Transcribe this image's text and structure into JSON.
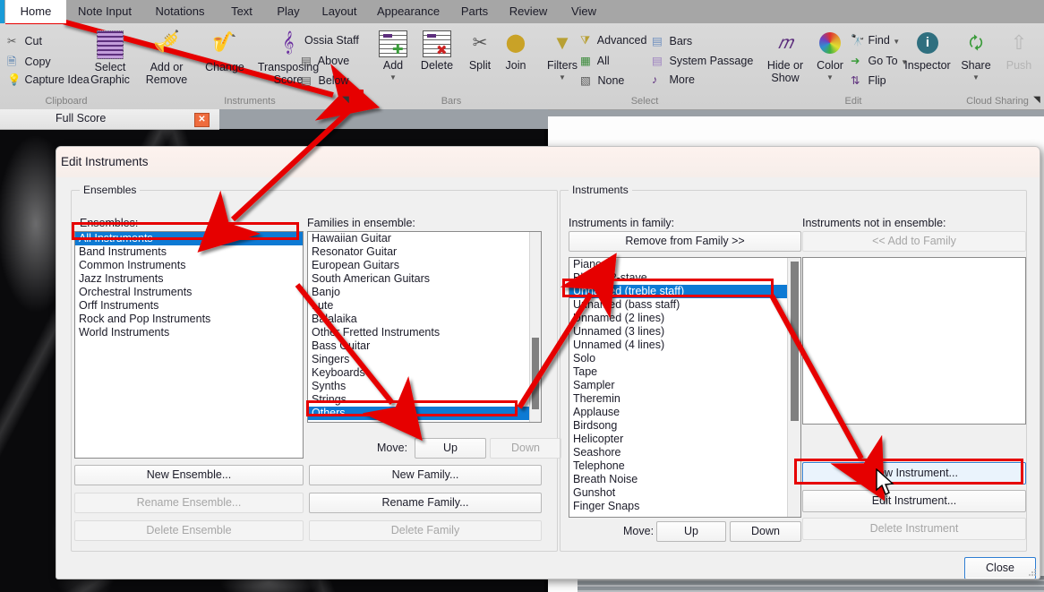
{
  "app": {
    "score_caption": "Full Score",
    "close_glyph": "✕"
  },
  "ribbon": {
    "tabs": [
      {
        "label": "Home",
        "active": true
      },
      {
        "label": "Note Input",
        "active": false
      },
      {
        "label": "Notations",
        "active": false
      },
      {
        "label": "Text",
        "active": false
      },
      {
        "label": "Play",
        "active": false
      },
      {
        "label": "Layout",
        "active": false
      },
      {
        "label": "Appearance",
        "active": false
      },
      {
        "label": "Parts",
        "active": false
      },
      {
        "label": "Review",
        "active": false
      },
      {
        "label": "View",
        "active": false
      }
    ],
    "groups": [
      {
        "name": "Clipboard",
        "title": "Clipboard",
        "small_items": [
          {
            "label": "Cut",
            "icon": "scissors-icon"
          },
          {
            "label": "Copy",
            "icon": "copy-icon"
          },
          {
            "label": "Capture Idea",
            "icon": "lightbulb-icon"
          }
        ],
        "big_items": [
          {
            "label": "Select\nGraphic",
            "icon": "select-graphic-icon"
          }
        ]
      },
      {
        "name": "Instruments",
        "title": "Instruments",
        "big_items": [
          {
            "label": "Add or\nRemove",
            "icon": "trumpet-icon"
          },
          {
            "label": "Change",
            "icon": "saxophone-icon"
          },
          {
            "label": "Transposing\nScore",
            "icon": "transposing-icon"
          }
        ],
        "small_items": [
          {
            "label": "Ossia Staff",
            "icon": "ossia-icon"
          },
          {
            "label": "Above",
            "icon": "staff-above-icon"
          },
          {
            "label": "Below",
            "icon": "staff-below-icon"
          }
        ],
        "has_launcher": true
      },
      {
        "name": "Bars",
        "title": "Bars",
        "big_items": [
          {
            "label": "Add",
            "icon": "bar-add-icon",
            "has_dropdown": true
          },
          {
            "label": "Delete",
            "icon": "bar-delete-icon"
          },
          {
            "label": "Split",
            "icon": "bar-split-icon"
          },
          {
            "label": "Join",
            "icon": "bar-join-icon"
          }
        ]
      },
      {
        "name": "Select",
        "title": "Select",
        "big_items": [
          {
            "label": "Filters",
            "icon": "funnel-icon",
            "has_dropdown": true
          }
        ],
        "small_items": [
          {
            "label": "Advanced",
            "icon": "advanced-filter-icon"
          },
          {
            "label": "All",
            "icon": "select-all-icon"
          },
          {
            "label": "None",
            "icon": "select-none-icon"
          },
          {
            "label": "Bars",
            "icon": "bars-select-icon"
          },
          {
            "label": "System Passage",
            "icon": "system-passage-icon"
          },
          {
            "label": "More",
            "icon": "more-select-icon"
          }
        ]
      },
      {
        "name": "Edit",
        "title": "Edit",
        "big_items": [
          {
            "label": "Hide or\nShow",
            "icon": "hide-show-icon",
            "has_dropdown": true
          },
          {
            "label": "Color",
            "icon": "color-wheel-icon",
            "has_dropdown": true
          },
          {
            "label": "Inspector",
            "icon": "inspector-info-icon"
          }
        ],
        "small_items": [
          {
            "label": "Find",
            "icon": "binoculars-icon"
          },
          {
            "label": "Go To",
            "icon": "goto-arrow-icon"
          },
          {
            "label": "Flip",
            "icon": "flip-icon"
          }
        ]
      },
      {
        "name": "Cloud Sharing",
        "title": "Cloud Sharing",
        "big_items": [
          {
            "label": "Share",
            "icon": "share-icon",
            "has_dropdown": true
          },
          {
            "label": "Push",
            "icon": "push-up-arrow-icon",
            "disabled": true
          }
        ],
        "has_launcher": true
      }
    ]
  },
  "dialog": {
    "title": "Edit Instruments",
    "ensembles_group_label": "Ensembles",
    "instruments_group_label": "Instruments",
    "ensembles_list_label": "Ensembles:",
    "families_list_label": "Families in ensemble:",
    "instruments_in_family_label": "Instruments in family:",
    "instruments_not_in_ensemble_label": "Instruments not in ensemble:",
    "ensembles": [
      "All Instruments",
      "Band Instruments",
      "Common Instruments",
      "Jazz Instruments",
      "Orchestral Instruments",
      "Orff Instruments",
      "Rock and Pop Instruments",
      "World Instruments"
    ],
    "ensembles_selected": "All Instruments",
    "families": [
      "Hawaiian Guitar",
      "Resonator Guitar",
      "European Guitars",
      "South American Guitars",
      "Banjo",
      "Lute",
      "Balalaika",
      "Other Fretted Instruments",
      "Bass Guitar",
      "Singers",
      "Keyboards",
      "Synths",
      "Strings",
      "Others"
    ],
    "families_selected": "Others",
    "instruments_in_family": [
      "Piano",
      "Blank 12-stave",
      "Unnamed (treble staff)",
      "Unnamed (bass staff)",
      "Unnamed (2 lines)",
      "Unnamed (3 lines)",
      "Unnamed (4 lines)",
      "Solo",
      "Tape",
      "Sampler",
      "Theremin",
      "Applause",
      "Birdsong",
      "Helicopter",
      "Seashore",
      "Telephone",
      "Breath Noise",
      "Gunshot",
      "Finger Snaps"
    ],
    "instruments_selected": "Unnamed (treble staff)",
    "instruments_not_in_ensemble": [],
    "buttons": {
      "remove_from_family": "Remove from Family >>",
      "add_to_family": "<< Add to Family",
      "new_ensemble": "New Ensemble...",
      "rename_ensemble": "Rename Ensemble...",
      "delete_ensemble": "Delete Ensemble",
      "new_family": "New Family...",
      "rename_family": "Rename Family...",
      "delete_family": "Delete Family",
      "new_instrument": "New Instrument...",
      "edit_instrument": "Edit Instrument...",
      "delete_instrument": "Delete Instrument",
      "close": "Close",
      "move_label": "Move:",
      "move_up": "Up",
      "move_down": "Down"
    }
  },
  "annotations": {
    "accent_color": "#e60000",
    "highlight_color": "#0d7ad4",
    "boxes": [
      {
        "name": "home-tab-highlight"
      },
      {
        "name": "instruments-launcher-highlight"
      },
      {
        "name": "all-instruments-highlight"
      },
      {
        "name": "others-family-highlight"
      },
      {
        "name": "unnamed-treble-staff-highlight"
      },
      {
        "name": "new-instrument-highlight"
      }
    ]
  }
}
